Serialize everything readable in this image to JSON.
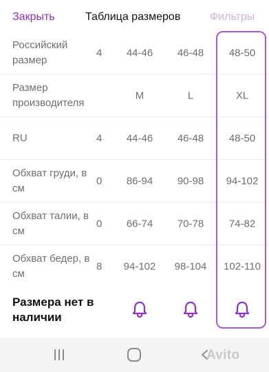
{
  "header": {
    "close_label": "Закрыть",
    "title": "Таблица размеров",
    "filters_label": "Фильтры"
  },
  "table": {
    "rows": [
      {
        "label": "Российский размер",
        "values": [
          "4",
          "44-46",
          "46-48",
          "48-50"
        ]
      },
      {
        "label": "Размер производителя",
        "values": [
          "",
          "M",
          "L",
          "XL"
        ]
      },
      {
        "label": "RU",
        "values": [
          "4",
          "44-46",
          "46-48",
          "48-50"
        ]
      },
      {
        "label": "Обхват груди, в см",
        "values": [
          "0",
          "86-94",
          "90-98",
          "94-102"
        ]
      },
      {
        "label": "Обхват талии, в см",
        "values": [
          "0",
          "66-74",
          "70-78",
          "74-82"
        ]
      },
      {
        "label": "Обхват бедер, в см",
        "values": [
          "8",
          "94-102",
          "98-104",
          "102-110"
        ]
      }
    ],
    "highlighted_column": "XL"
  },
  "availability": {
    "label": "Размера нет в наличии",
    "icon": "bell-icon"
  },
  "colors": {
    "accent": "#8f2fd0",
    "highlight_border": "#a35cd9"
  },
  "watermark": {
    "text": "Avito"
  }
}
